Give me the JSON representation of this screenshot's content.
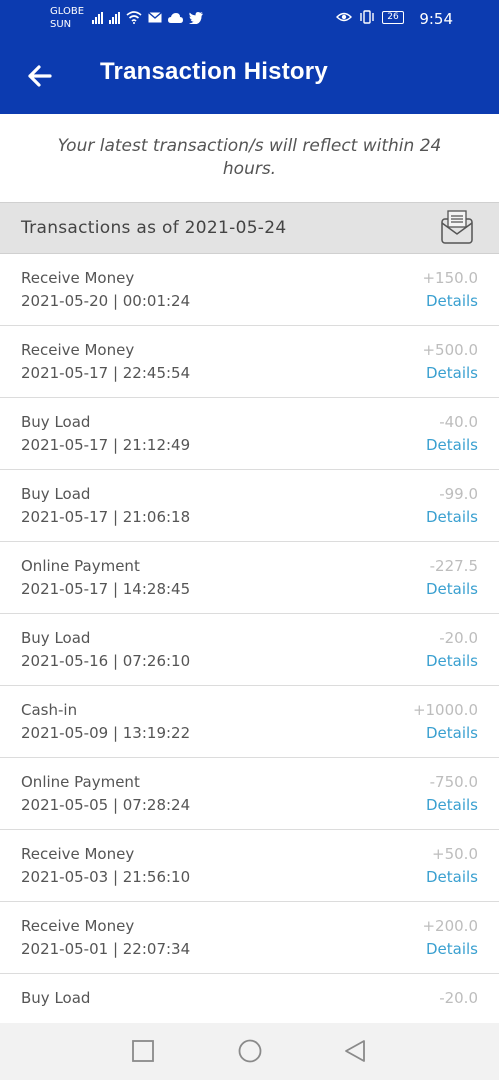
{
  "status_bar": {
    "carrier1": "GLOBE",
    "carrier2": "SUN",
    "battery": "26",
    "time": "9:54"
  },
  "app_bar": {
    "title": "Transaction History",
    "color": "#0c3bb0"
  },
  "notice": "Your latest transaction/s will reflect within 24 hours.",
  "section_header": "Transactions as of 2021-05-24",
  "transactions": [
    {
      "type": "Receive Money",
      "datetime": "2021-05-20 | 00:01:24",
      "amount": "+150.0",
      "details": "Details"
    },
    {
      "type": "Receive Money",
      "datetime": "2021-05-17 | 22:45:54",
      "amount": "+500.0",
      "details": "Details"
    },
    {
      "type": "Buy Load",
      "datetime": "2021-05-17 | 21:12:49",
      "amount": "-40.0",
      "details": "Details"
    },
    {
      "type": "Buy Load",
      "datetime": "2021-05-17 | 21:06:18",
      "amount": "-99.0",
      "details": "Details"
    },
    {
      "type": "Online Payment",
      "datetime": "2021-05-17 | 14:28:45",
      "amount": "-227.5",
      "details": "Details"
    },
    {
      "type": "Buy Load",
      "datetime": "2021-05-16 | 07:26:10",
      "amount": "-20.0",
      "details": "Details"
    },
    {
      "type": "Cash-in",
      "datetime": "2021-05-09 | 13:19:22",
      "amount": "+1000.0",
      "details": "Details"
    },
    {
      "type": "Online Payment",
      "datetime": "2021-05-05 | 07:28:24",
      "amount": "-750.0",
      "details": "Details"
    },
    {
      "type": "Receive Money",
      "datetime": "2021-05-03 | 21:56:10",
      "amount": "+50.0",
      "details": "Details"
    },
    {
      "type": "Receive Money",
      "datetime": "2021-05-01 | 22:07:34",
      "amount": "+200.0",
      "details": "Details"
    },
    {
      "type": "Buy Load",
      "datetime": "",
      "amount": "-20.0",
      "details": ""
    }
  ],
  "icons": {
    "back": "back-arrow-icon",
    "download": "download-statement-icon",
    "nav_recents": "square-icon",
    "nav_home": "circle-icon",
    "nav_back": "triangle-back-icon"
  }
}
